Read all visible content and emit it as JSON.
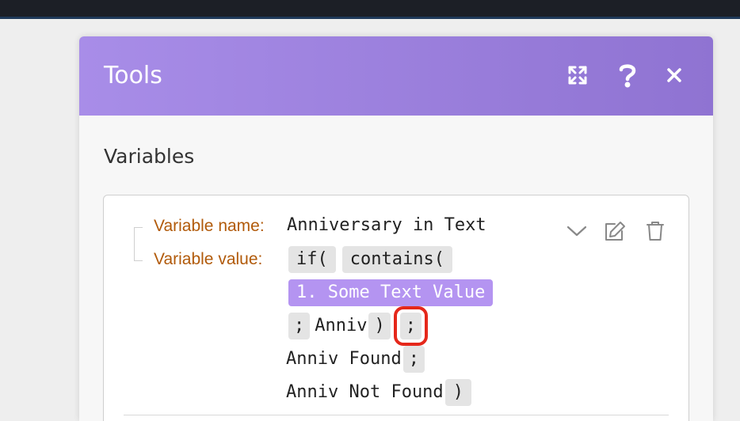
{
  "modal": {
    "title": "Tools",
    "header_icons": [
      "expand-icon",
      "help-icon",
      "close-icon"
    ],
    "accent_color": "#9b7fdd"
  },
  "section": {
    "title": "Variables"
  },
  "variable": {
    "name_label": "Variable name:",
    "name_value": "Anniversary in Text",
    "value_label": "Variable value:",
    "tokens": {
      "if_fn": "if(",
      "contains_fn": "contains(",
      "mapped_value": "1. Some Text Value",
      "sep1": ";",
      "anniv_text": "Anniv",
      "close1": ")",
      "sep2": ";",
      "found_text": "Anniv Found",
      "sep3": ";",
      "not_found_text": "Anniv Not Found",
      "close2": ")"
    },
    "highlight_color": "#e5281b",
    "card_icons": [
      "chevron-down-icon",
      "edit-icon",
      "trash-icon"
    ]
  }
}
